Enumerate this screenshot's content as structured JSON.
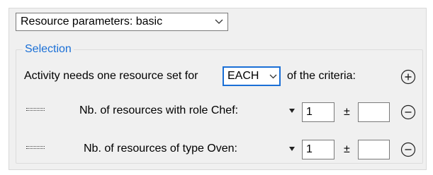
{
  "param_select": {
    "value": "Resource parameters: basic"
  },
  "selection": {
    "legend": "Selection",
    "prefix": "Activity needs one resource set for",
    "mode": "EACH",
    "suffix": "of the criteria:"
  },
  "rows": [
    {
      "label": "Nb. of resources with role Chef:",
      "value": "1",
      "plusminus": "±",
      "tolerance": ""
    },
    {
      "label": "Nb. of resources of type Oven:",
      "value": "1",
      "plusminus": "±",
      "tolerance": ""
    }
  ],
  "icons": {
    "add": "plus-circle-icon",
    "remove": "minus-circle-icon",
    "drag": "drag-handle-icon",
    "dropdown": "chevron-down-icon",
    "caret": "caret-down-icon"
  },
  "colors": {
    "accent": "#1a6fd6",
    "panel": "#f0f0f0"
  }
}
